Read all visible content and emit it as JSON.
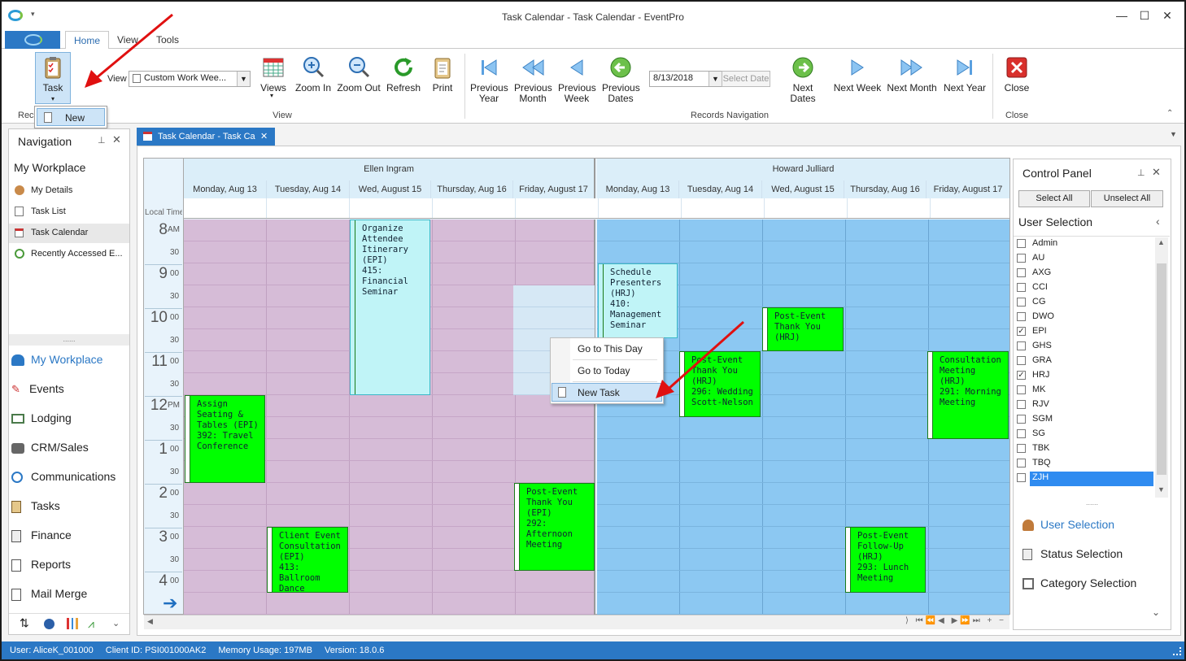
{
  "window": {
    "title": "Task Calendar - Task Calendar - EventPro"
  },
  "ribbon": {
    "tabs": [
      "Home",
      "View",
      "Tools"
    ],
    "task_label": "Task",
    "new_label": "New",
    "records_group": "Reco",
    "view_label": "View",
    "view_select": "Custom Work Wee...",
    "views_label": "Views",
    "zoom_in": "Zoom In",
    "zoom_out": "Zoom Out",
    "refresh": "Refresh",
    "print": "Print",
    "view_group": "View",
    "prev_year": [
      "Previous",
      "Year"
    ],
    "prev_month": [
      "Previous",
      "Month"
    ],
    "prev_week": [
      "Previous",
      "Week"
    ],
    "prev_dates": [
      "Previous",
      "Dates"
    ],
    "date_value": "8/13/2018",
    "select_date": "Select Date",
    "next_dates": "Next Dates",
    "next_week": "Next Week",
    "next_month": "Next Month",
    "next_year": "Next Year",
    "records_nav_group": "Records Navigation",
    "close": "Close",
    "close_group": "Close"
  },
  "navigation": {
    "title": "Navigation",
    "workplace": "My Workplace",
    "items": [
      "My Details",
      "Task List",
      "Task Calendar",
      "Recently Accessed E..."
    ],
    "modules": [
      "My Workplace",
      "Events",
      "Lodging",
      "CRM/Sales",
      "Communications",
      "Tasks",
      "Finance",
      "Reports",
      "Mail Merge"
    ]
  },
  "doc_tab": {
    "label": "Task Calendar - Task Ca"
  },
  "calendar": {
    "local_time": "Local Time",
    "resources": [
      "Ellen Ingram",
      "Howard Julliard"
    ],
    "days": [
      "Monday, Aug 13",
      "Tuesday, Aug 14",
      "Wed, August 15",
      "Thursday, Aug 16",
      "Friday, August 17"
    ],
    "hours": [
      {
        "h": "8",
        "m": "AM"
      },
      {
        "h": "9",
        "m": "00"
      },
      {
        "h": "10",
        "m": "00"
      },
      {
        "h": "11",
        "m": "00"
      },
      {
        "h": "12",
        "m": "PM"
      },
      {
        "h": "1",
        "m": "00"
      },
      {
        "h": "2",
        "m": "00"
      },
      {
        "h": "3",
        "m": "00"
      },
      {
        "h": "4",
        "m": "00"
      }
    ],
    "half": "30",
    "appointments": [
      "Organize\nAttendee\nItinerary (EPI)\n415: Financial\nSeminar",
      "Assign\nSeating &\nTables (EPI)\n392: Travel\nConference",
      "Client Event\nConsultation\n(EPI)\n413: Ballroom\nDance",
      "Post-Event\nThank You\n(EPI)\n292:\nAfternoon\nMeeting",
      "Schedule\nPresenters\n(HRJ)\n410:\nManagement\nSeminar",
      "Post-Event\nThank You\n(HRJ)",
      "Post-Event\nThank You\n(HRJ)\n296: Wedding\nScott-Nelson",
      "Consultation\nMeeting (HRJ)\n291: Morning\nMeeting",
      "Post-Event\nFollow-Up\n(HRJ)\n293: Lunch\nMeeting"
    ],
    "colors": {
      "ellen_bg": "#d6bcd7",
      "howard_bg": "#8cc8f2",
      "appt_green": "#00ff00"
    }
  },
  "context_menu": {
    "items": [
      "Go to This Day",
      "Go to Today",
      "New Task"
    ]
  },
  "control_panel": {
    "title": "Control Panel",
    "select_all": "Select All",
    "unselect_all": "Unselect All",
    "user_selection": "User Selection",
    "users": [
      {
        "name": "Admin",
        "checked": false
      },
      {
        "name": "AU",
        "checked": false
      },
      {
        "name": "AXG",
        "checked": false
      },
      {
        "name": "CCI",
        "checked": false
      },
      {
        "name": "CG",
        "checked": false
      },
      {
        "name": "DWO",
        "checked": false
      },
      {
        "name": "EPI",
        "checked": true
      },
      {
        "name": "GHS",
        "checked": false
      },
      {
        "name": "GRA",
        "checked": false
      },
      {
        "name": "HRJ",
        "checked": true
      },
      {
        "name": "MK",
        "checked": false
      },
      {
        "name": "RJV",
        "checked": false
      },
      {
        "name": "SGM",
        "checked": false
      },
      {
        "name": "SG",
        "checked": false
      },
      {
        "name": "TBK",
        "checked": false
      },
      {
        "name": "TBQ",
        "checked": false
      },
      {
        "name": "ZJH",
        "checked": false
      }
    ],
    "sections": [
      "User Selection",
      "Status Selection",
      "Category Selection"
    ]
  },
  "status_bar": {
    "user": "User: AliceK_001000",
    "client": "Client ID: PSI001000AK2",
    "memory": "Memory Usage: 197MB",
    "version": "Version: 18.0.6"
  }
}
